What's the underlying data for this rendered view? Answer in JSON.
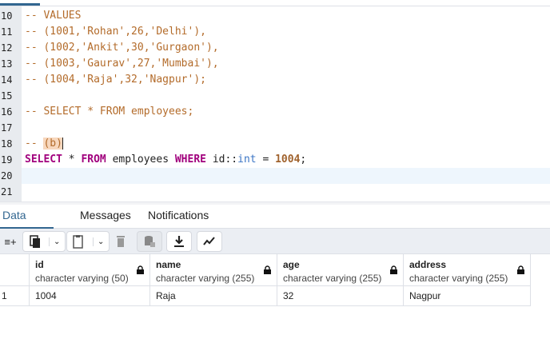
{
  "editor": {
    "lines": [
      {
        "n": "10",
        "t": "-- VALUES"
      },
      {
        "n": "11",
        "t": "-- (1001,'Rohan',26,'Delhi'),"
      },
      {
        "n": "12",
        "t": "-- (1002,'Ankit',30,'Gurgaon'),"
      },
      {
        "n": "13",
        "t": "-- (1003,'Gaurav',27,'Mumbai'),"
      },
      {
        "n": "14",
        "t": "-- (1004,'Raja',32,'Nagpur');"
      },
      {
        "n": "15",
        "t": ""
      },
      {
        "n": "16",
        "t": "-- SELECT * FROM employees;"
      },
      {
        "n": "17",
        "t": ""
      },
      {
        "n": "18",
        "t": "-- ",
        "h": "(b)"
      },
      {
        "n": "19",
        "t": ""
      },
      {
        "n": "20",
        "t": ""
      },
      {
        "n": "21",
        "t": ""
      }
    ],
    "query": {
      "kw1": "SELECT",
      "star": " * ",
      "kw2": "FROM",
      "tbl": " employees ",
      "kw3": "WHERE",
      "col": " id::",
      "type": "int",
      "eq": " = ",
      "num": "1004",
      "end": ";"
    }
  },
  "tabs": [
    "Data Output",
    "Messages",
    "Notifications"
  ],
  "columns": [
    {
      "name": "id",
      "type": "character varying (50)"
    },
    {
      "name": "name",
      "type": "character varying (255)"
    },
    {
      "name": "age",
      "type": "character varying (255)"
    },
    {
      "name": "address",
      "type": "character varying (255)"
    }
  ],
  "rows": [
    {
      "n": "1",
      "cells": [
        "1004",
        "Raja",
        "32",
        "Nagpur"
      ]
    }
  ]
}
